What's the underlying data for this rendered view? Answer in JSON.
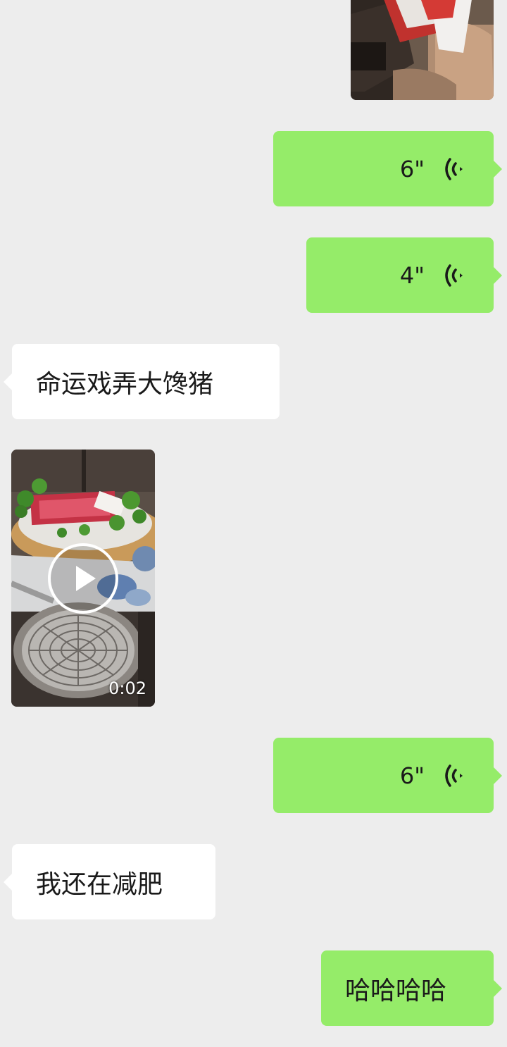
{
  "messages": [
    {
      "type": "image",
      "side": "right"
    },
    {
      "type": "voice",
      "side": "right",
      "duration": "6\""
    },
    {
      "type": "voice",
      "side": "right",
      "duration": "4\""
    },
    {
      "type": "text",
      "side": "left",
      "text": "命运戏弄大馋猪"
    },
    {
      "type": "video",
      "side": "left",
      "duration": "0:02"
    },
    {
      "type": "voice",
      "side": "right",
      "duration": "6\""
    },
    {
      "type": "text",
      "side": "left",
      "text": "我还在减肥"
    },
    {
      "type": "text",
      "side": "right",
      "text": "哈哈哈哈"
    }
  ],
  "colors": {
    "background": "#ededed",
    "sent_bubble": "#95ec69",
    "received_bubble": "#ffffff",
    "text": "#1a1a1a"
  },
  "icons": {
    "voice": "voice-wave-icon",
    "play": "play-icon"
  }
}
